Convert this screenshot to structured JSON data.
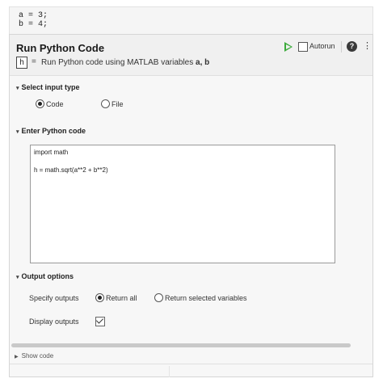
{
  "code": {
    "lines": [
      "a = 3;",
      "b = 4;"
    ]
  },
  "task": {
    "title": "Run Python Code",
    "autorun_label": "Autorun",
    "help_glyph": "?",
    "kebab_glyph": "⋮",
    "output_var": "h",
    "equals": "=",
    "description_prefix": "Run Python code using MATLAB variables ",
    "description_vars": "a, b",
    "icons": [
      "run-icon",
      "help-icon",
      "kebab-icon",
      "chevron-down-icon",
      "chevron-right-icon",
      "check-icon"
    ],
    "colors": {
      "run": "#3bab3b"
    }
  },
  "select_input": {
    "heading": "Select input type",
    "options": [
      "Code",
      "File"
    ],
    "selected": "Code"
  },
  "enter_code": {
    "heading": "Enter Python code",
    "lines": [
      "import math",
      "",
      "h = math.sqrt(a**2 + b**2)"
    ]
  },
  "output_options": {
    "heading": "Output options",
    "specify_label": "Specify outputs",
    "specify_options": [
      "Return all",
      "Return selected variables"
    ],
    "specify_selected": "Return all",
    "display_label": "Display outputs",
    "display_checked": true
  },
  "show_code": "Show code"
}
